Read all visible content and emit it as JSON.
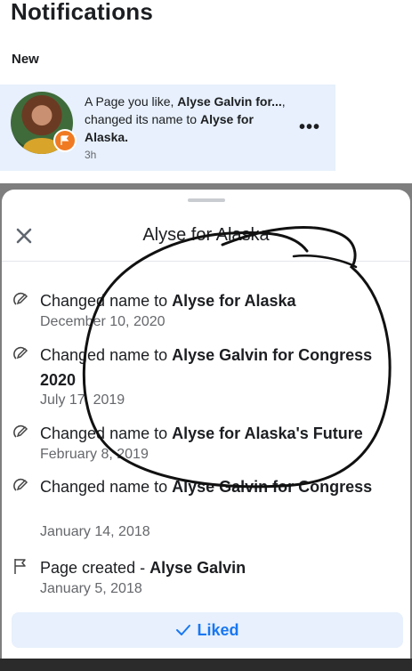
{
  "header": {
    "title": "Notifications",
    "section_new": "New"
  },
  "notification": {
    "pre": "A Page you like, ",
    "old_name_bold": "Alyse Galvin for...",
    "mid": ", changed its name to ",
    "new_name_bold": "Alyse for Alaska.",
    "time": "3h",
    "more_label": "•••"
  },
  "sheet": {
    "title": "Alyse for Alaska",
    "history": [
      {
        "icon": "edit-icon",
        "prefix": "Changed name to ",
        "name": "Alyse for Alaska",
        "date": "December 10, 2020"
      },
      {
        "icon": "edit-icon",
        "prefix": "Changed name to ",
        "name": "Alyse Galvin for Congress 2020",
        "date": "July 17, 2019"
      },
      {
        "icon": "edit-icon",
        "prefix": "Changed name to ",
        "name": "Alyse for Alaska's Future",
        "date": "February 8, 2019"
      },
      {
        "icon": "edit-icon",
        "prefix": "Changed name to ",
        "name": "Alyse Galvin for Congress",
        "date": "January 14, 2018"
      },
      {
        "icon": "flag-icon",
        "prefix": "Page created - ",
        "name": "Alyse Galvin",
        "date": "January 5, 2018"
      }
    ],
    "liked_label": "Liked"
  },
  "colors": {
    "accent": "#1877f2",
    "highlight_bg": "#e7f0fc",
    "badge": "#f07a22",
    "muted": "#65676b"
  }
}
